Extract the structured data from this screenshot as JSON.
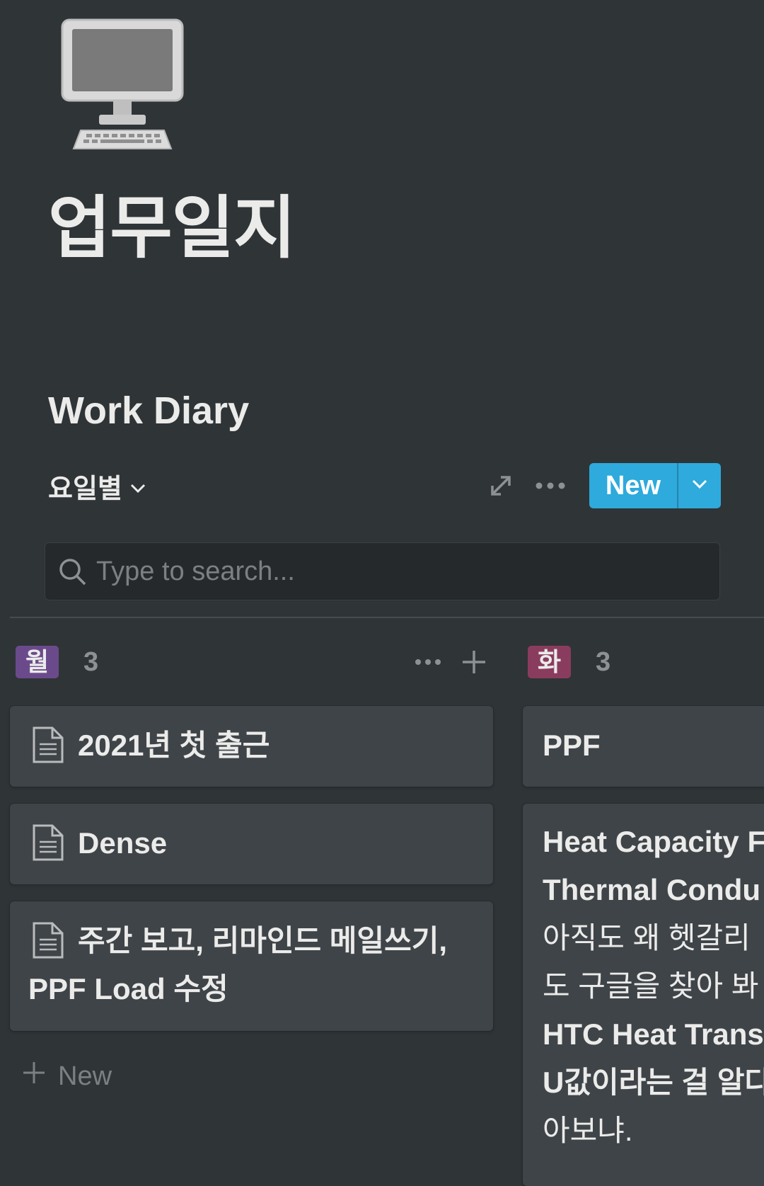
{
  "page": {
    "icon": "desktop-computer-icon",
    "title": "업무일지"
  },
  "database": {
    "title": "Work Diary",
    "view_label": "요일별",
    "new_label": "New",
    "search_placeholder": "Type to search..."
  },
  "colors": {
    "background": "#2f3437",
    "accent": "#2eaadc",
    "card": "#3f4448",
    "tag_mon": "#6b4a8c",
    "tag_tue": "#8a3c5e"
  },
  "groups": [
    {
      "tag": "월",
      "count": "3",
      "cards": [
        {
          "title": "2021년 첫 출근",
          "icon": "page-icon"
        },
        {
          "title": "Dense",
          "icon": "page-icon"
        },
        {
          "title_line1": "주간 보고, 리마인드 메일쓰기,",
          "title_line2": "PPF Load 수정",
          "icon": "page-icon"
        }
      ],
      "add_label": "New"
    },
    {
      "tag": "화",
      "count": "3",
      "cards": [
        {
          "title": "PPF"
        },
        {
          "lines": [
            "Heat Capacity F",
            "Thermal Condu",
            "아직도 왜 헷갈리",
            "도 구글을 찾아 봐",
            "HTC Heat Trans",
            "U값이라는 걸 알다",
            "아보냐."
          ]
        }
      ]
    }
  ]
}
